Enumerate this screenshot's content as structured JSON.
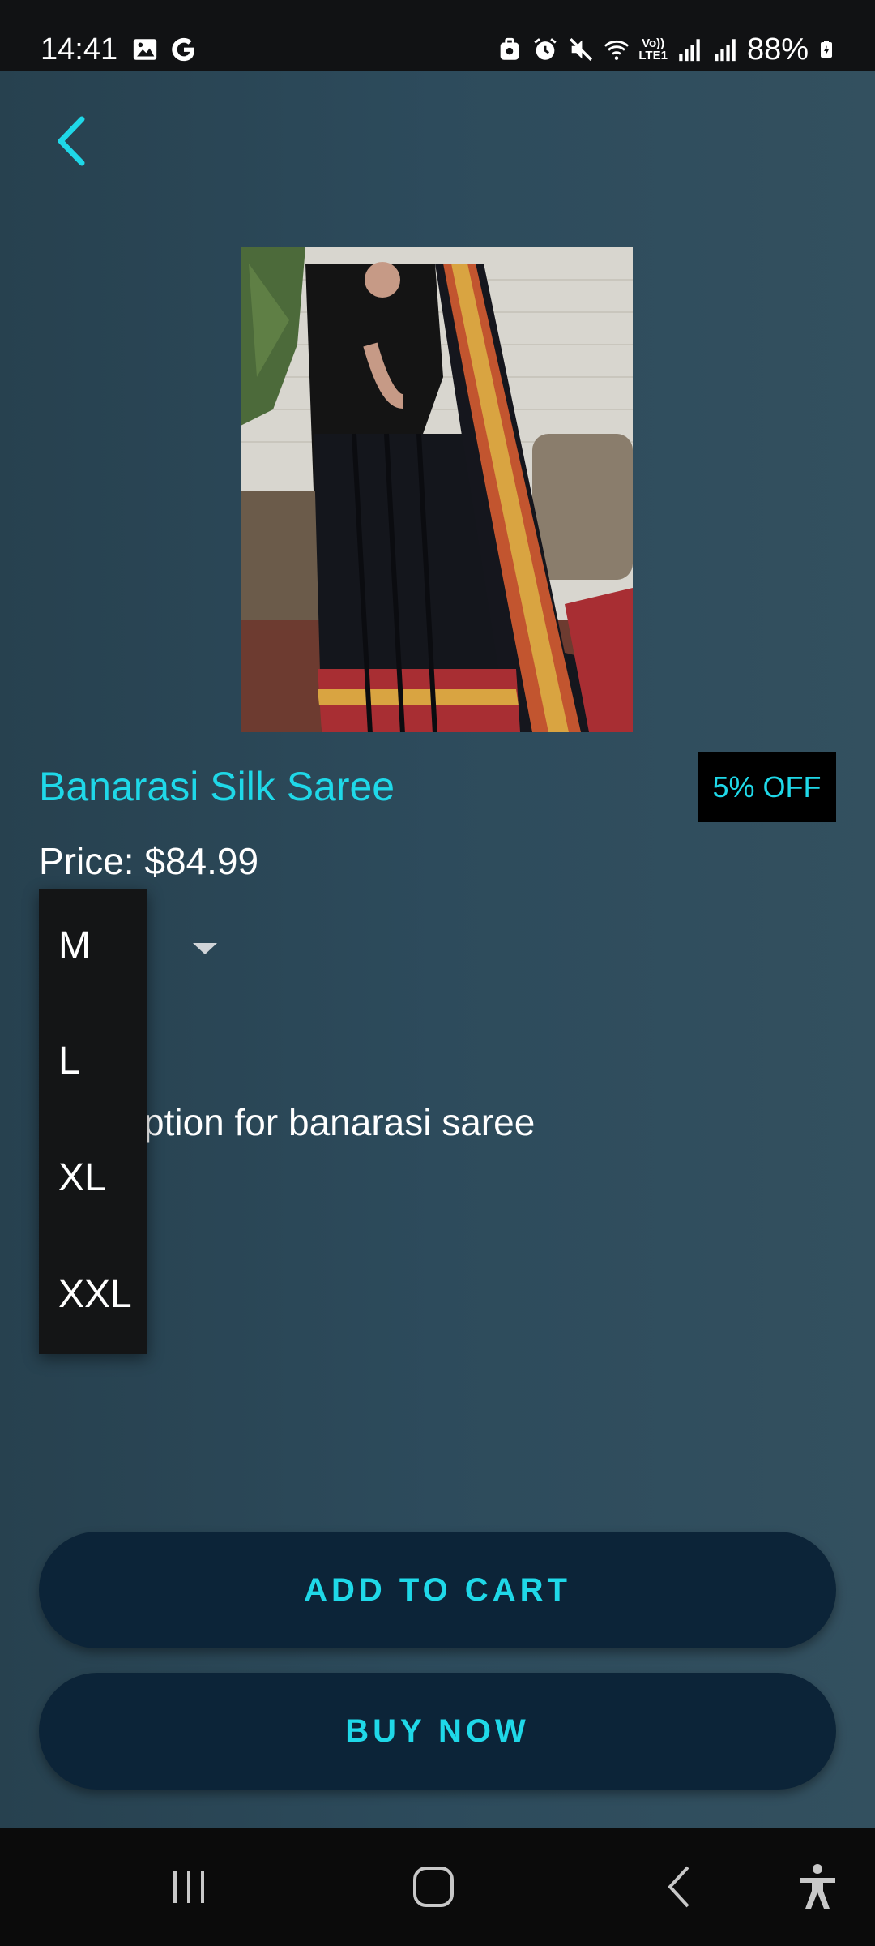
{
  "status_bar": {
    "time": "14:41",
    "battery": "88%",
    "left_icons": [
      "image-icon",
      "google-icon"
    ],
    "right_icons": [
      "work-profile-icon",
      "alarm-icon",
      "mute-icon",
      "wifi-icon",
      "volte-icon",
      "signal-icon",
      "signal-icon-2",
      "battery-charging-icon"
    ],
    "volte_label": "Vo))\nLTE1"
  },
  "header": {
    "back_icon": "chevron-left-icon"
  },
  "product": {
    "title": "Banarasi Silk Saree",
    "discount": "5% OFF",
    "price": "Price: $84.99",
    "description": "ption for banarasi saree",
    "image_alt": "black saree with red and gold border"
  },
  "size_dropdown": {
    "options": [
      "M",
      "L",
      "XL",
      "XXL"
    ]
  },
  "actions": {
    "add_to_cart": "ADD TO CART",
    "buy_now": "BUY NOW"
  },
  "nav": {
    "icons": [
      "recents-icon",
      "home-icon",
      "back-icon",
      "accessibility-icon"
    ]
  },
  "colors": {
    "accent": "#1fd8e8",
    "background": "#2d4a5a",
    "button": "#0c2438"
  }
}
